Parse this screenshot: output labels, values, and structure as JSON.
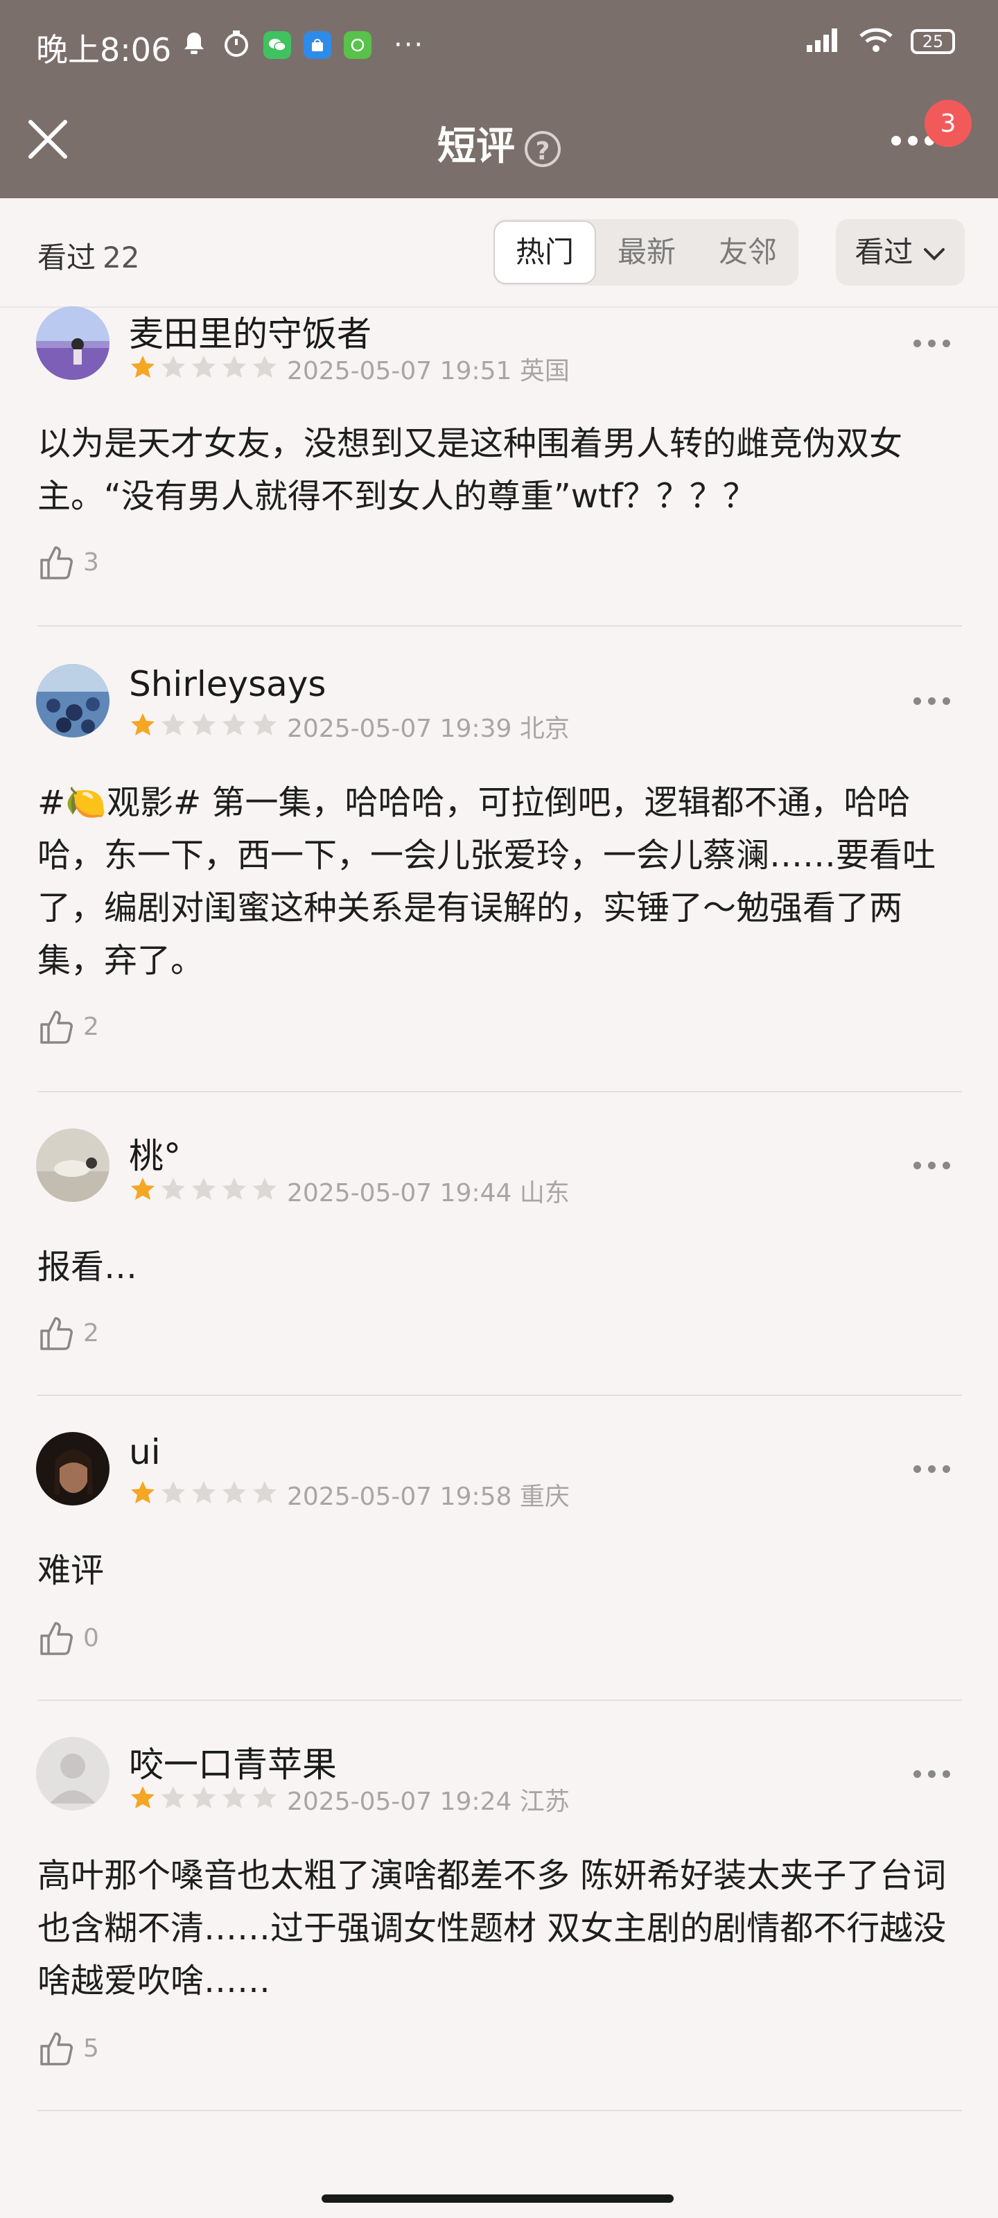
{
  "status_bar": {
    "time": "晚上8:06",
    "battery": "25",
    "more": "···"
  },
  "nav": {
    "title": "短评",
    "help": "?",
    "badge": "3"
  },
  "filter": {
    "seen_label": "看过",
    "seen_count": "22",
    "tabs": [
      "热门",
      "最新",
      "友邻"
    ],
    "active_tab": "热门",
    "dropdown_label": "看过"
  },
  "colors": {
    "header_bg": "#7b6f6c",
    "page_bg": "#f7f4f3",
    "star_filled": "#f5a623",
    "star_empty": "#dcd8d6",
    "badge": "#f25a5a"
  },
  "comments": [
    {
      "username": "麦田里的守饭者",
      "rating": 1,
      "datetime": "2025-05-07 19:51",
      "location": "英国",
      "text": "以为是天才女友，没想到又是这种围着男人转的雌竞伪双女主。“没有男人就得不到女人的尊重”wtf？？？？",
      "likes": "3"
    },
    {
      "username": "Shirleysays",
      "rating": 1,
      "datetime": "2025-05-07 19:39",
      "location": "北京",
      "text": "#🍋观影# 第一集，哈哈哈，可拉倒吧，逻辑都不通，哈哈哈，东一下，西一下，一会儿张爱玲，一会儿蔡澜……要看吐了，编剧对闺蜜这种关系是有误解的，实锤了～勉强看了两集，弃了。",
      "likes": "2"
    },
    {
      "username": "桃°",
      "rating": 1,
      "datetime": "2025-05-07 19:44",
      "location": "山东",
      "text": "报看…",
      "likes": "2"
    },
    {
      "username": "ui",
      "rating": 1,
      "datetime": "2025-05-07 19:58",
      "location": "重庆",
      "text": "难评",
      "likes": "0"
    },
    {
      "username": "咬一口青苹果",
      "rating": 1,
      "datetime": "2025-05-07 19:24",
      "location": "江苏",
      "text": "高叶那个嗓音也太粗了演啥都差不多 陈妍希好装太夹子了台词也含糊不清……过于强调女性题材 双女主剧的剧情都不行越没啥越爱吹啥……",
      "likes": "5"
    }
  ]
}
